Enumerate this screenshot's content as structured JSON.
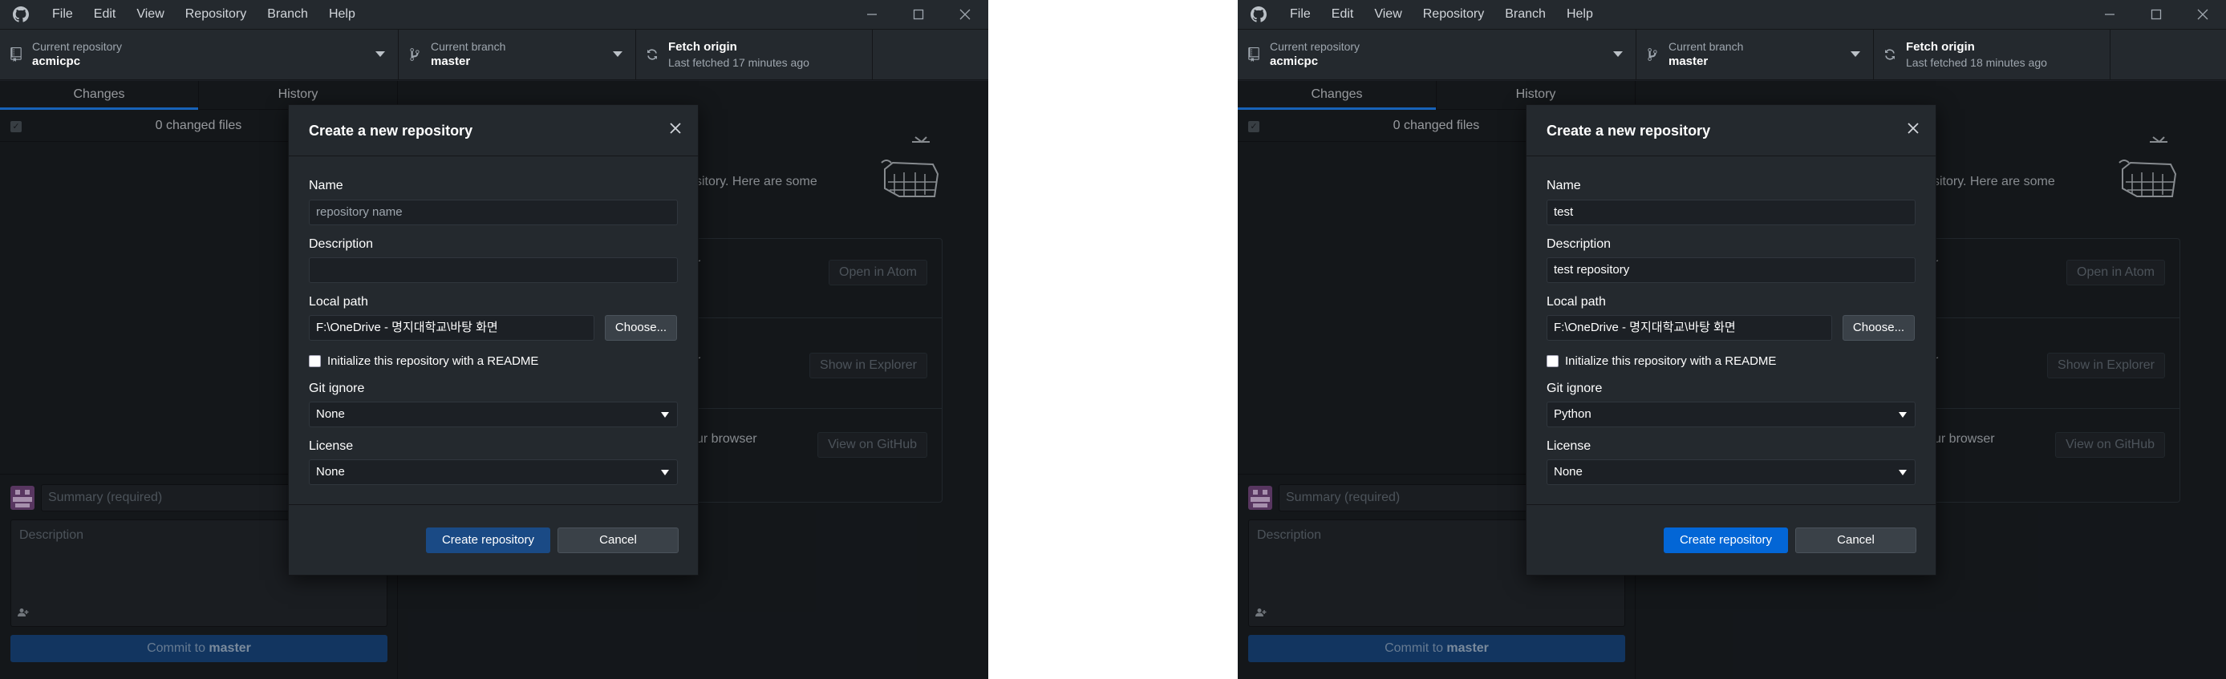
{
  "windows": [
    {
      "menu": [
        "File",
        "Edit",
        "View",
        "Repository",
        "Branch",
        "Help"
      ],
      "toolbar": {
        "repo_label": "Current repository",
        "repo_value": "acmicpc",
        "branch_label": "Current branch",
        "branch_value": "master",
        "fetch_label": "Fetch origin",
        "fetch_sub": "Last fetched 17 minutes ago"
      },
      "tabs": [
        "Changes",
        "History"
      ],
      "changed_files": "0 changed files",
      "summary_placeholder": "Summary (required)",
      "description_placeholder": "Description",
      "commit_prefix": "Commit to ",
      "commit_branch": "master",
      "background": {
        "intro_fragment": "sitory. Here are some",
        "row1_fragment": "r",
        "row1_button": "Open in Atom",
        "row2_fragment": "r",
        "row2_button": "Show in Explorer",
        "row3_fragment": "ur browser",
        "row3_button": "View on GitHub"
      },
      "dialog": {
        "title": "Create a new repository",
        "name_label": "Name",
        "name_value": "",
        "name_placeholder": "repository name",
        "description_label": "Description",
        "description_value": "",
        "local_path_label": "Local path",
        "local_path_value": "F:\\OneDrive - 명지대학교\\바탕 화면",
        "choose_label": "Choose...",
        "readme_label": "Initialize this repository with a README",
        "gitignore_label": "Git ignore",
        "gitignore_value": "None",
        "license_label": "License",
        "license_value": "None",
        "create_label": "Create repository",
        "cancel_label": "Cancel",
        "create_enabled": false
      }
    },
    {
      "menu": [
        "File",
        "Edit",
        "View",
        "Repository",
        "Branch",
        "Help"
      ],
      "toolbar": {
        "repo_label": "Current repository",
        "repo_value": "acmicpc",
        "branch_label": "Current branch",
        "branch_value": "master",
        "fetch_label": "Fetch origin",
        "fetch_sub": "Last fetched 18 minutes ago"
      },
      "tabs": [
        "Changes",
        "History"
      ],
      "changed_files": "0 changed files",
      "summary_placeholder": "Summary (required)",
      "description_placeholder": "Description",
      "commit_prefix": "Commit to ",
      "commit_branch": "master",
      "background": {
        "intro_fragment": "sitory. Here are some",
        "row1_fragment": "r",
        "row1_button": "Open in Atom",
        "row2_fragment": "r",
        "row2_button": "Show in Explorer",
        "row3_fragment": "ur browser",
        "row3_button": "View on GitHub"
      },
      "dialog": {
        "title": "Create a new repository",
        "name_label": "Name",
        "name_value": "test",
        "name_placeholder": "repository name",
        "description_label": "Description",
        "description_value": "test repository",
        "local_path_label": "Local path",
        "local_path_value": "F:\\OneDrive - 명지대학교\\바탕 화면",
        "choose_label": "Choose...",
        "readme_label": "Initialize this repository with a README",
        "gitignore_label": "Git ignore",
        "gitignore_value": "Python",
        "license_label": "License",
        "license_value": "None",
        "create_label": "Create repository",
        "cancel_label": "Cancel",
        "create_enabled": true
      }
    }
  ],
  "colors": {
    "primary_enabled": "#0366d6",
    "primary_disabled": "#1a4a85"
  }
}
